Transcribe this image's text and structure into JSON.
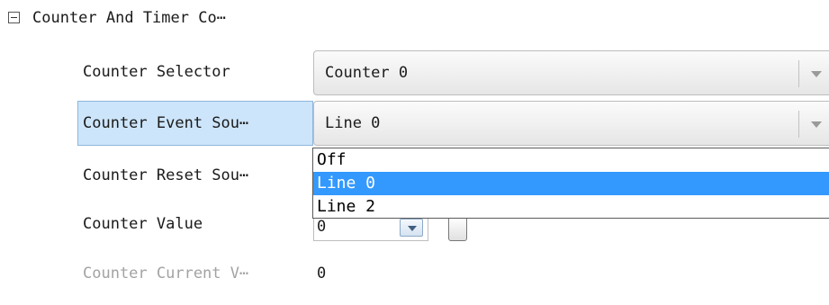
{
  "section": {
    "title": "Counter And Timer Co⋯",
    "collapsed": false
  },
  "properties": [
    {
      "label": "Counter Selector",
      "value": "Counter 0",
      "control": "combo"
    },
    {
      "label": "Counter Event Sou⋯",
      "value": "Line 0",
      "control": "combo",
      "selected": true
    },
    {
      "label": "Counter Reset Sou⋯",
      "value": "",
      "control": "combo"
    },
    {
      "label": "Counter Value",
      "value": "0",
      "control": "spinner"
    },
    {
      "label": "Counter Current V⋯",
      "value": "0",
      "control": "readonly",
      "disabled": true
    }
  ],
  "dropdown": {
    "options": [
      "Off",
      "Line 0",
      "Line 2"
    ],
    "highlighted": "Line 0",
    "highlight_color": "#3399ff"
  },
  "colors": {
    "selected_row_bg": "#cde5fa",
    "disabled_text": "#a3a3a3"
  }
}
